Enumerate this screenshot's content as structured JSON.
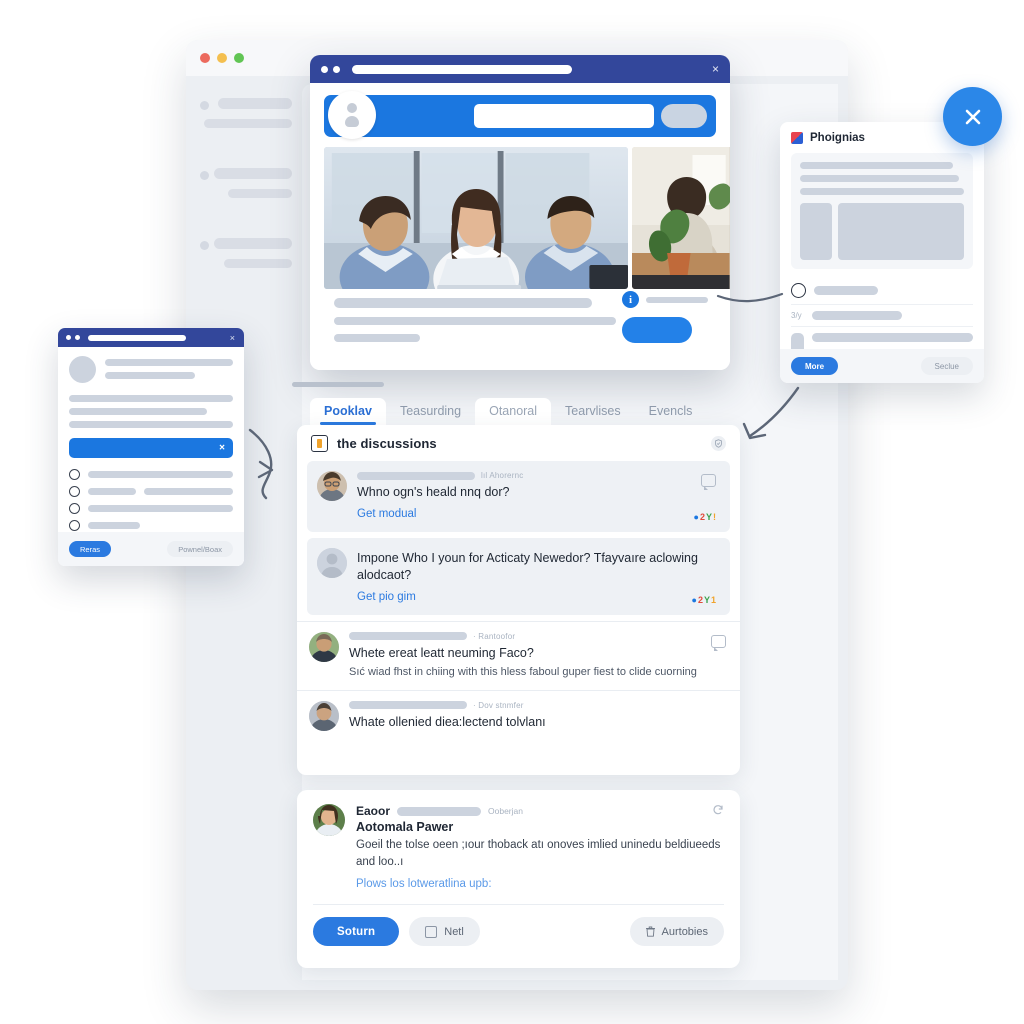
{
  "page": {
    "background_color": "#ffffff",
    "accent_color": "#2b7ae0",
    "deep_blue": "#33479b",
    "panel_gray": "#eceff3"
  },
  "bg_window": {
    "traffic_lights": [
      "close",
      "minimize",
      "zoom"
    ],
    "sidebar_skeleton_groups": 3
  },
  "browser": {
    "titlebar": {
      "url_placeholder": "",
      "close_label": "×"
    },
    "header": {
      "avatar_icon": "user-avatar-icon",
      "search_placeholder": "",
      "action_button_label": ""
    },
    "hero": {
      "main_image_alt": "three colleagues smiling around a laptop in an office",
      "side_image_alt": "man at a desk with a potted plant"
    },
    "body_lines": 3,
    "cta": {
      "info_badge": "i",
      "caption": "",
      "button_label": ""
    }
  },
  "tabs": [
    {
      "label": "Pooklav",
      "state": "active"
    },
    {
      "label": "Teasurding",
      "state": "default"
    },
    {
      "label": "Otanoral",
      "state": "raised"
    },
    {
      "label": "Tearvlises",
      "state": "default"
    },
    {
      "label": "Evencls",
      "state": "default"
    }
  ],
  "discussions": {
    "header": {
      "title": "the discussions",
      "icon": "bookmark-icon",
      "check_icon": "shield-check-icon"
    },
    "threads": [
      {
        "author_redacted": true,
        "meta": "lıl Ahorernc",
        "title": "Whno ogn's heald nnq dor?",
        "link": "Get modual",
        "highlighted": true,
        "reactions": "☉ 2Y!",
        "avatar": "man-glasses-avatar",
        "has_bubble": true
      },
      {
        "author_redacted": true,
        "meta": "",
        "title": "Impone Who I youn for Acticaty Newedor? Tfayvaıre aclowing alodcaot?",
        "link": "Get pio gim",
        "highlighted": true,
        "reactions": "☉ 2Y1",
        "avatar": "placeholder-avatar",
        "has_bubble": false
      },
      {
        "author_redacted": true,
        "meta": "· Rantoofor",
        "title": "Whete ereat leatt neuming Faco?",
        "body": "Sıć wiad fhst in chiing with this hless faboul guper fiest to clide cuorning",
        "highlighted": false,
        "avatar": "man-beard-avatar",
        "has_bubble": true
      },
      {
        "author_redacted": true,
        "meta": "· Dov stnmfer",
        "title": "Whate ollenied diea:lectend tolvlanı",
        "highlighted": false,
        "avatar": "young-man-avatar",
        "has_bubble": false
      }
    ]
  },
  "composer": {
    "author": "Eaoor",
    "author_redacted": true,
    "date": "Ooberjan",
    "headline": "Aotomala Pawer",
    "body": "Goeil the tolse oeen ;ıour thoback atı onoves imlied uninedu beldiueeds and loo..ı",
    "link": "Plows los lotweratlina upb:",
    "refresh_icon": "refresh-icon",
    "buttons": {
      "primary": "Soturn",
      "secondary": "Netl",
      "secondary_icon": "checkbox-icon",
      "tertiary": "Aurtobies",
      "tertiary_icon": "trash-icon"
    }
  },
  "left_window": {
    "titlebar": {
      "close_label": "×"
    },
    "banner_close_label": "×",
    "list_items": 5,
    "buttons": {
      "primary": "Reras",
      "secondary": "Pownel/Boax"
    }
  },
  "right_panel": {
    "title": "Phoignias",
    "logo_icon": "brand-logo-icon",
    "rows": [
      {
        "glyph": "globe-icon",
        "label": ""
      },
      {
        "glyph": "text",
        "label": "3/y"
      },
      {
        "glyph": "thumb",
        "label": ""
      }
    ],
    "buttons": {
      "primary": "More",
      "secondary": "Seclue"
    }
  },
  "fab": {
    "icon": "close-icon",
    "label": "×"
  }
}
